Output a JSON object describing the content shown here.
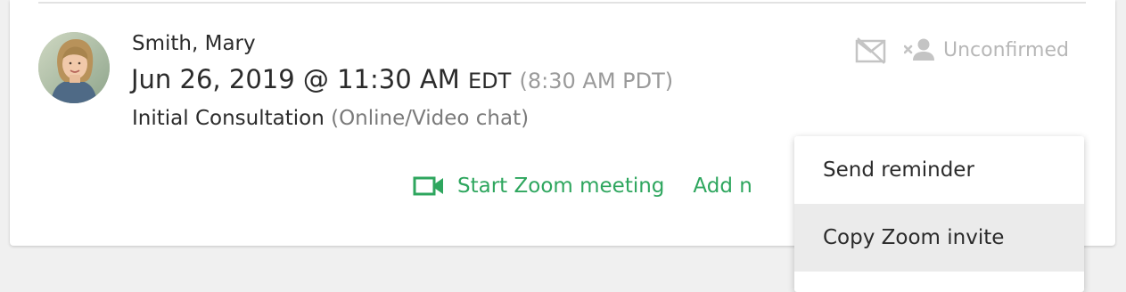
{
  "appointment": {
    "client_name": "Smith, Mary",
    "date_time": "Jun 26, 2019 @ 11:30 AM",
    "timezone": "EDT",
    "alt_time": "(8:30 AM PDT)",
    "service": "Initial Consultation",
    "service_mode": "(Online/Video chat)",
    "status_label": "Unconfirmed"
  },
  "actions": {
    "start_zoom_label": "Start Zoom meeting",
    "add_label": "Add n"
  },
  "menu": {
    "items": [
      {
        "label": "Send reminder"
      },
      {
        "label": "Copy Zoom invite"
      }
    ]
  },
  "icons": {
    "no_email": "no-email-icon",
    "unconfirmed": "unconfirmed-person-icon",
    "video": "video-camera-icon"
  },
  "colors": {
    "accent_green": "#2ea65e",
    "muted_gray": "#b7b7b7",
    "text_dark": "#2b2b2b",
    "menu_highlight": "#ebebeb"
  }
}
